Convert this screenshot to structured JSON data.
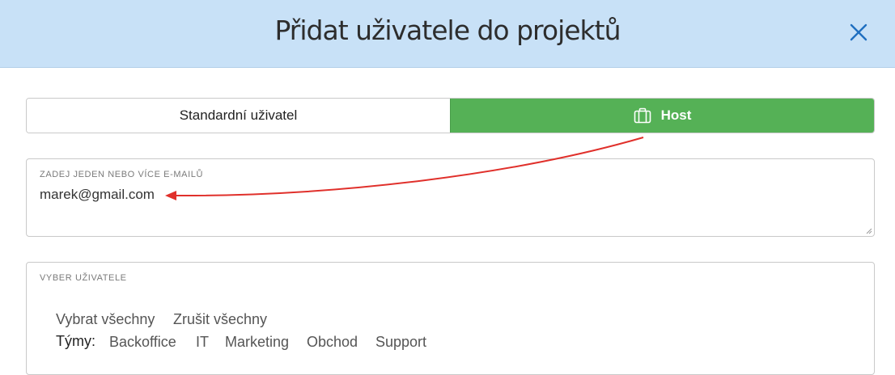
{
  "dialog": {
    "title": "Přidat uživatele do projektů",
    "close_icon": "close-icon"
  },
  "user_type": {
    "options": [
      {
        "label": "Standardní uživatel",
        "selected": false
      },
      {
        "label": "Host",
        "selected": true,
        "icon": "suitcase-icon"
      }
    ],
    "active_color": "#55b156"
  },
  "email": {
    "label": "ZADEJ JEDEN NEBO VÍCE E-MAILŮ",
    "value": "marek@gmail.com"
  },
  "users": {
    "label": "VYBER UŽIVATELE",
    "select_all": "Vybrat všechny",
    "deselect_all": "Zrušit všechny",
    "teams_label": "Týmy:",
    "teams": [
      "Backoffice",
      "IT",
      "Marketing",
      "Obchod",
      "Support"
    ]
  },
  "colors": {
    "header_bg": "#c8e1f7",
    "close_icon": "#1f6fc0",
    "annotation_arrow": "#e0302b"
  }
}
